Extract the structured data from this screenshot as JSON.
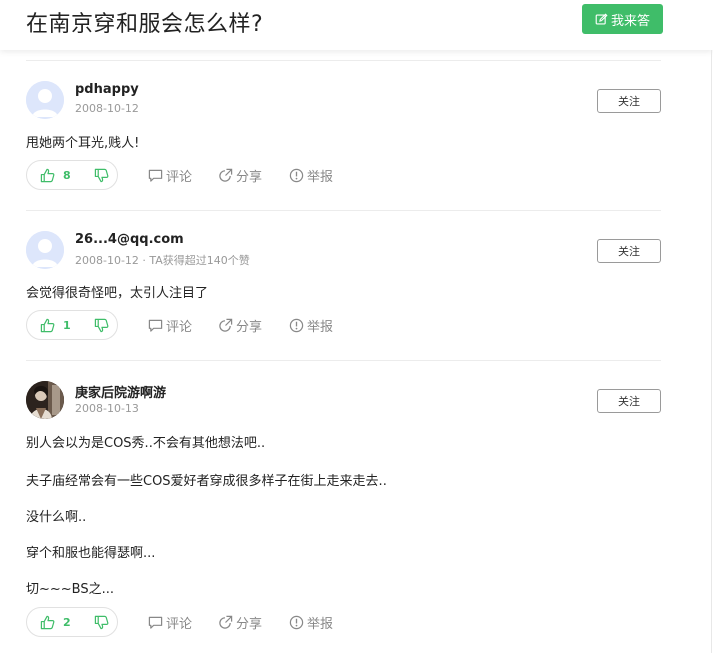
{
  "question": {
    "title": "在南京穿和服会怎么样?",
    "answer_button_label": "我来答"
  },
  "labels": {
    "follow": "关注",
    "comment": "评论",
    "share": "分享",
    "report": "举报"
  },
  "answers": [
    {
      "username": "pdhappy",
      "meta": "2008-10-12",
      "paragraphs": [
        "甩她两个耳光,贱人!"
      ],
      "likes": "8",
      "avatar": "default-avatar"
    },
    {
      "username": "26...4@qq.com",
      "meta": "2008-10-12 · TA获得超过140个赞",
      "paragraphs": [
        "会觉得很奇怪吧，太引人注目了"
      ],
      "likes": "1",
      "avatar": "default-avatar"
    },
    {
      "username": "庚家后院游啊游",
      "meta": "2008-10-13",
      "paragraphs": [
        "别人会以为是COS秀..不会有其他想法吧..",
        "夫子庙经常会有一些COS爱好者穿成很多样子在街上走来走去..",
        "没什么啊..",
        "穿个和服也能得瑟啊...",
        "切~~~BS之..."
      ],
      "likes": "2",
      "avatar": "photo-avatar"
    }
  ],
  "colors": {
    "accent_green": "#3fbd69",
    "muted_text": "#999999",
    "avatar_bg": "#dde6fb"
  }
}
